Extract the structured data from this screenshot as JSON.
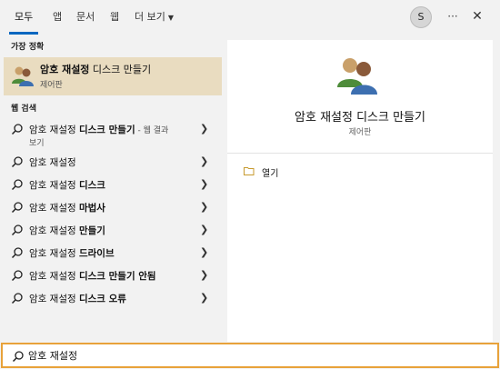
{
  "tabs": [
    {
      "label": "모두",
      "active": true
    },
    {
      "label": "앱",
      "active": false
    },
    {
      "label": "문서",
      "active": false
    },
    {
      "label": "웹",
      "active": false
    },
    {
      "label": "더 보기",
      "active": false
    }
  ],
  "header": {
    "avatar_letter": "S",
    "more_label": "···",
    "close_label": "✕"
  },
  "best_match": {
    "section_label": "가장 정확",
    "title_bold": "암호 재설정",
    "title_rest": " 디스크 만들기",
    "subtitle": "제어판",
    "icon": "users-icon"
  },
  "web_search": {
    "section_label": "웹 검색",
    "items": [
      {
        "prefix": "암호 재설정 ",
        "bold": "디스크 만들기",
        "extra": " - 웹 결과",
        "cont": "보기"
      },
      {
        "prefix": "암호 재설정",
        "bold": "",
        "extra": ""
      },
      {
        "prefix": "암호 재설정 ",
        "bold": "디스크",
        "extra": ""
      },
      {
        "prefix": "암호 재설정 ",
        "bold": "마법사",
        "extra": ""
      },
      {
        "prefix": "암호 재설정 ",
        "bold": "만들기",
        "extra": ""
      },
      {
        "prefix": "암호 재설정 ",
        "bold": "드라이브",
        "extra": ""
      },
      {
        "prefix": "암호 재설정 ",
        "bold": "디스크 만들기 안됨",
        "extra": ""
      },
      {
        "prefix": "암호 재설정 ",
        "bold": "디스크 오류",
        "extra": ""
      }
    ]
  },
  "preview": {
    "title": "암호 재설정 디스크 만들기",
    "subtitle": "제어판",
    "open_label": "열기"
  },
  "search": {
    "value": "암호 재설정",
    "placeholder": ""
  },
  "colors": {
    "accent": "#0067c0",
    "highlight": "#e9dcc0",
    "search_border": "#e8a23a"
  }
}
